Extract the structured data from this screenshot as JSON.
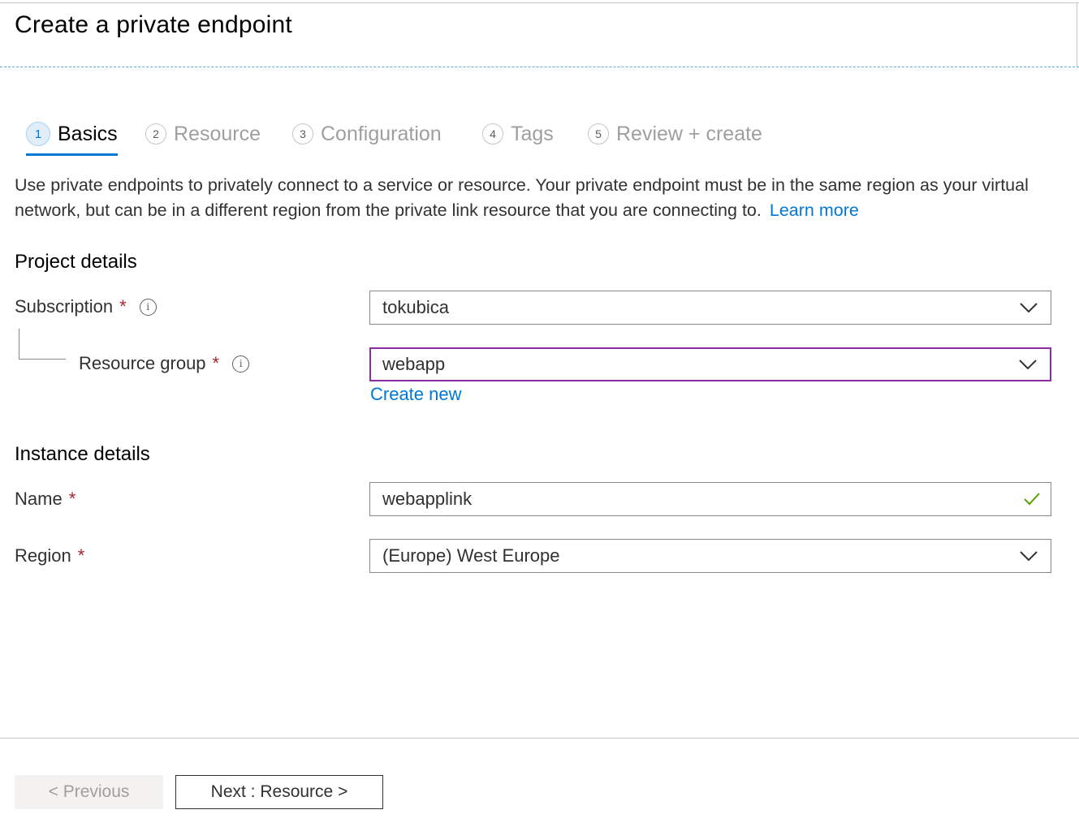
{
  "header": {
    "title": "Create a private endpoint"
  },
  "tabs": [
    {
      "number": "1",
      "label": "Basics",
      "active": true
    },
    {
      "number": "2",
      "label": "Resource",
      "active": false
    },
    {
      "number": "3",
      "label": "Configuration",
      "active": false
    },
    {
      "number": "4",
      "label": "Tags",
      "active": false
    },
    {
      "number": "5",
      "label": "Review + create",
      "active": false
    }
  ],
  "description": {
    "text": "Use private endpoints to privately connect to a service or resource. Your private endpoint must be in the same region as your virtual network, but can be in a different region from the private link resource that you are connecting to.",
    "link": "Learn more"
  },
  "project_details": {
    "heading": "Project details",
    "subscription": {
      "label": "Subscription",
      "required_mark": "*",
      "value": "tokubica"
    },
    "resource_group": {
      "label": "Resource group",
      "required_mark": "*",
      "value": "webapp",
      "create_new": "Create new"
    }
  },
  "instance_details": {
    "heading": "Instance details",
    "name": {
      "label": "Name",
      "required_mark": "*",
      "value": "webapplink"
    },
    "region": {
      "label": "Region",
      "required_mark": "*",
      "value": "(Europe) West Europe"
    }
  },
  "footer": {
    "previous_label": "< Previous",
    "next_label": "Next : Resource >"
  },
  "colors": {
    "accent": "#0078d4",
    "focus_border": "#8a2da5",
    "required": "#a4262c",
    "valid_check": "#57a300"
  },
  "icons": {
    "info": "info-icon",
    "dropdown": "chevron-down-icon",
    "valid": "checkmark-icon"
  }
}
